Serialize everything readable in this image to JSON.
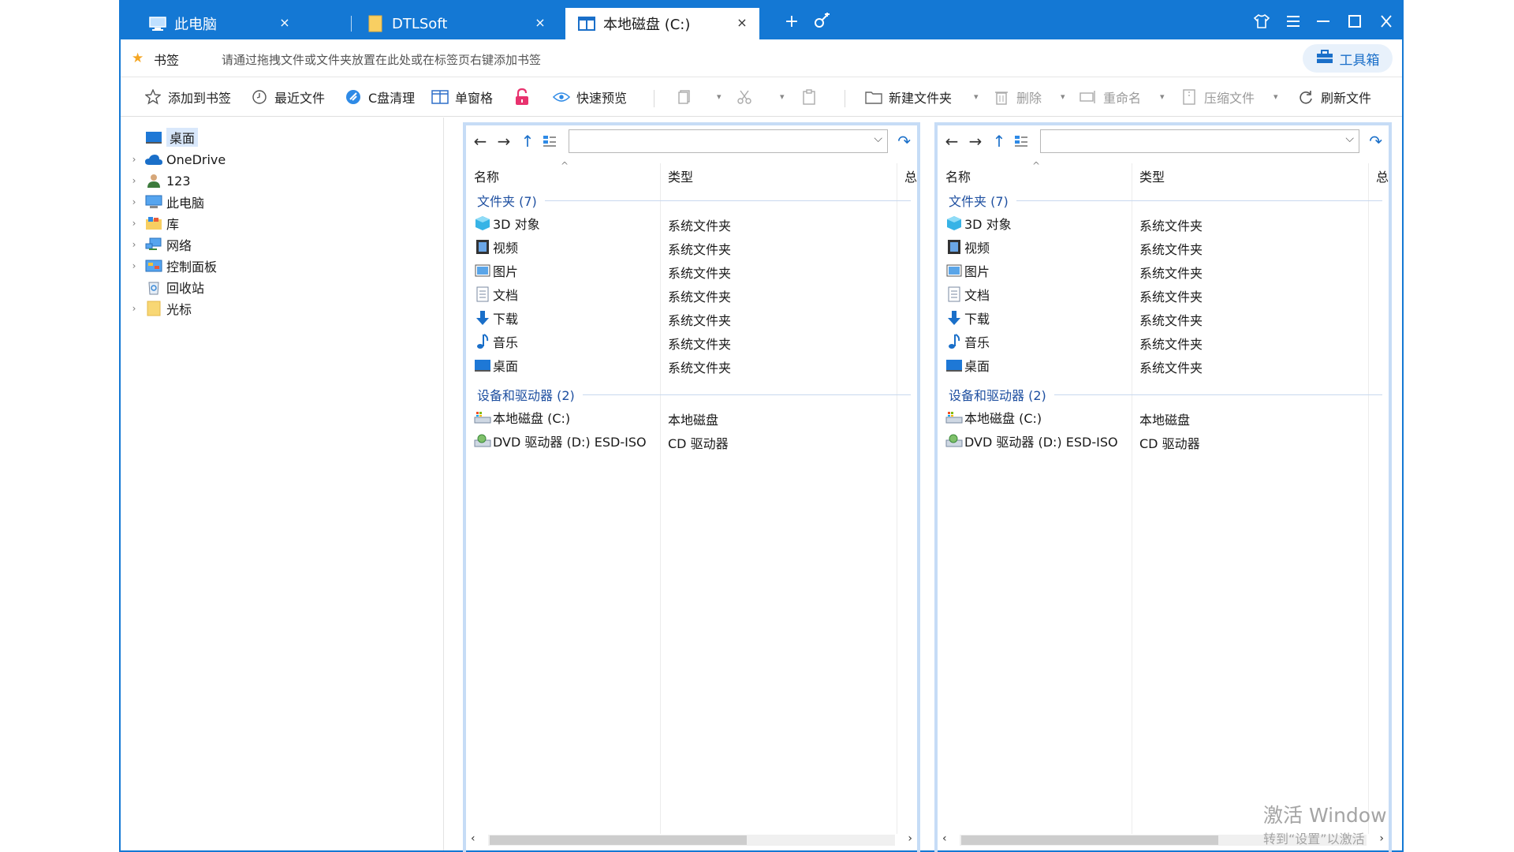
{
  "tabs": [
    {
      "label": "此电脑",
      "icon": "computer-icon"
    },
    {
      "label": "DTLSoft",
      "icon": "folder-icon"
    },
    {
      "label": "本地磁盘 (C:)",
      "icon": "split-pane-icon"
    }
  ],
  "titlebar": {
    "close_glyph": "×"
  },
  "bookmarks": {
    "label": "书签",
    "hint": "请通过拖拽文件或文件夹放置在此处或在标签页右键添加书签",
    "toolbox_label": "工具箱"
  },
  "toolbar": {
    "add_bookmark": "添加到书签",
    "recent_files": "最近文件",
    "c_clean": "C盘清理",
    "single_pane": "单窗格",
    "quick_preview": "快速预览",
    "new_folder": "新建文件夹",
    "delete": "删除",
    "rename": "重命名",
    "compress": "压缩文件",
    "refresh": "刷新文件"
  },
  "tree": [
    {
      "label": "桌面",
      "icon": "desktop-icon",
      "expandable": false,
      "selected": true
    },
    {
      "label": "OneDrive",
      "icon": "cloud-icon",
      "expandable": true
    },
    {
      "label": "123",
      "icon": "user-icon",
      "expandable": true
    },
    {
      "label": "此电脑",
      "icon": "computer-icon",
      "expandable": true
    },
    {
      "label": "库",
      "icon": "library-icon",
      "expandable": true
    },
    {
      "label": "网络",
      "icon": "network-icon",
      "expandable": true
    },
    {
      "label": "控制面板",
      "icon": "control-panel-icon",
      "expandable": true
    },
    {
      "label": "回收站",
      "icon": "recycle-bin-icon",
      "expandable": false
    },
    {
      "label": "光标",
      "icon": "folder-icon",
      "expandable": true
    }
  ],
  "pane": {
    "columns": {
      "name": "名称",
      "type": "类型",
      "total": "总"
    },
    "group_folders": "文件夹 (7)",
    "group_devices": "设备和驱动器 (2)",
    "folders": [
      {
        "name": "3D 对象",
        "type": "系统文件夹",
        "icon": "3d-objects-icon"
      },
      {
        "name": "视频",
        "type": "系统文件夹",
        "icon": "video-icon"
      },
      {
        "name": "图片",
        "type": "系统文件夹",
        "icon": "pictures-icon"
      },
      {
        "name": "文档",
        "type": "系统文件夹",
        "icon": "documents-icon"
      },
      {
        "name": "下载",
        "type": "系统文件夹",
        "icon": "download-icon"
      },
      {
        "name": "音乐",
        "type": "系统文件夹",
        "icon": "music-icon"
      },
      {
        "name": "桌面",
        "type": "系统文件夹",
        "icon": "desktop-icon"
      }
    ],
    "devices": [
      {
        "name": "本地磁盘 (C:)",
        "type": "本地磁盘",
        "icon": "local-disk-icon"
      },
      {
        "name": "DVD 驱动器 (D:) ESD-ISO",
        "type": "CD 驱动器",
        "icon": "dvd-drive-icon"
      }
    ]
  },
  "watermark": {
    "line1": "激活 Window",
    "line2": "转到“设置”以激活"
  },
  "colors": {
    "accent": "#1478d4",
    "group_text": "#1e4fa0",
    "pane_border": "#c6dcf6"
  }
}
